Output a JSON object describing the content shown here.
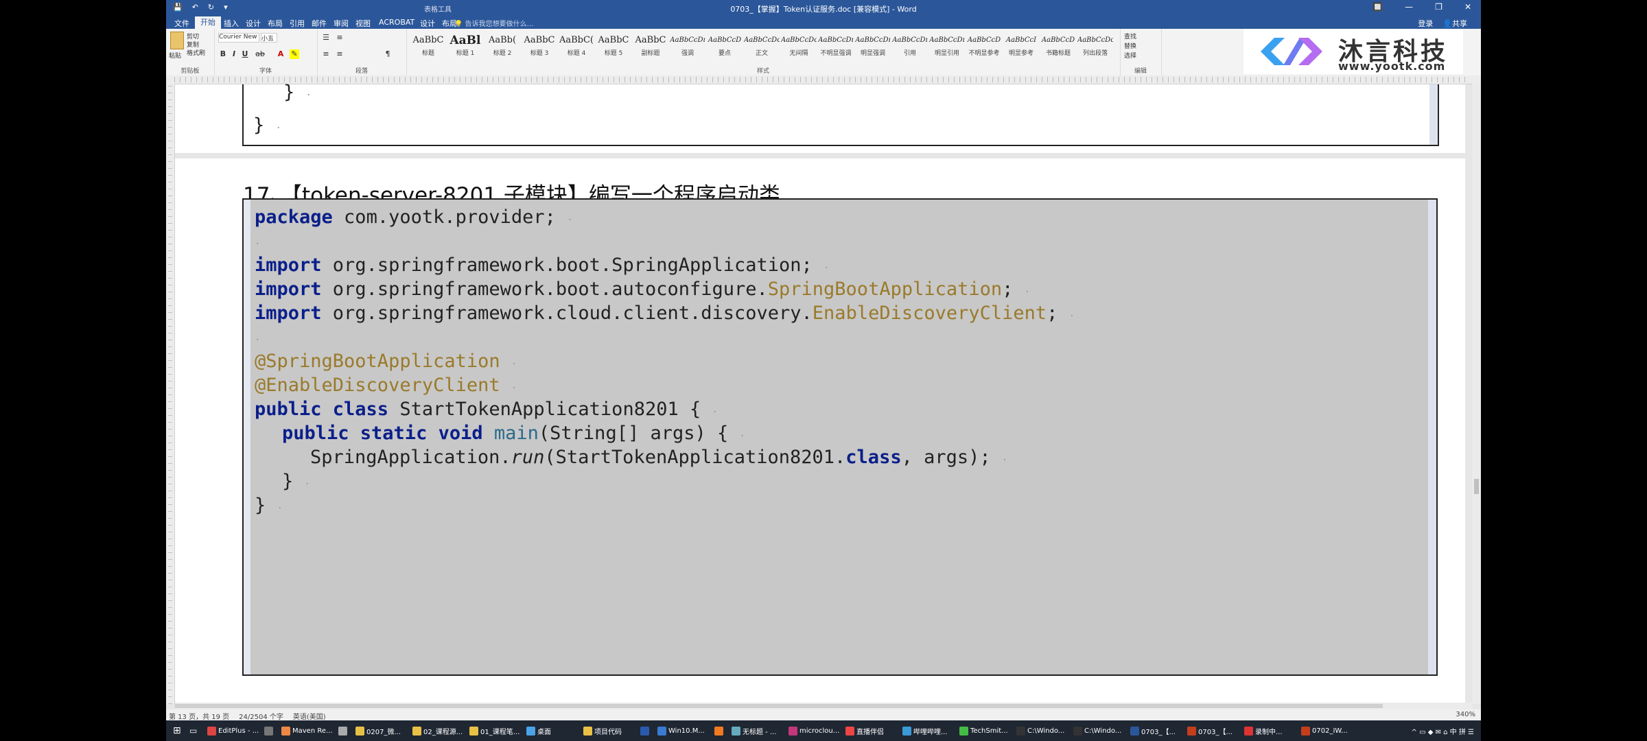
{
  "titlebar": {
    "title": "0703_【掌握】Token认证服务.doc [兼容模式] - Word",
    "context_tab": "表格工具",
    "qat": [
      "💾",
      "↶",
      "↻",
      "▾"
    ],
    "window_buttons": [
      "🔲",
      "—",
      "❐",
      "✕"
    ]
  },
  "tabs": {
    "items": [
      "文件",
      "开始",
      "插入",
      "设计",
      "布局",
      "引用",
      "邮件",
      "审阅",
      "视图",
      "ACROBAT",
      "设计",
      "布局"
    ],
    "search_placeholder": "告诉我您想要做什么...",
    "login": "登录",
    "share": "共享"
  },
  "ribbon": {
    "clipboard": {
      "paste": "粘贴",
      "cut": "剪切",
      "copy": "复制",
      "format_painter": "格式刷",
      "label": "剪贴板"
    },
    "font": {
      "font_name": "Courier New",
      "font_size": "小五",
      "label": "字体"
    },
    "paragraph": {
      "label": "段落"
    },
    "styles": {
      "label": "样式",
      "items": [
        {
          "preview": "AaBbC",
          "name": "标题"
        },
        {
          "preview": "AaBl",
          "name": "标题 1"
        },
        {
          "preview": "AaBb(",
          "name": "标题 2"
        },
        {
          "preview": "AaBbC",
          "name": "标题 3"
        },
        {
          "preview": "AaBbC(",
          "name": "标题 4"
        },
        {
          "preview": "AaBbC",
          "name": "标题 5"
        },
        {
          "preview": "AaBbC",
          "name": "副标题"
        },
        {
          "preview": "AaBbCcDı",
          "name": "强调"
        },
        {
          "preview": "AaBbCcD",
          "name": "要点"
        },
        {
          "preview": "AaBbCcDc",
          "name": "正文"
        },
        {
          "preview": "AaBbCcDc",
          "name": "无间隔"
        },
        {
          "preview": "AaBbCcDı",
          "name": "不明显强调"
        },
        {
          "preview": "AaBbCcDı",
          "name": "明显强调"
        },
        {
          "preview": "AaBbCcDı",
          "name": "引用"
        },
        {
          "preview": "AaBbCcDı",
          "name": "明显引用"
        },
        {
          "preview": "AaBbCcD",
          "name": "不明显参考"
        },
        {
          "preview": "AaBbCcI",
          "name": "明显参考"
        },
        {
          "preview": "AaBbCcD",
          "name": "书籍标题"
        },
        {
          "preview": "AaBbCcDc",
          "name": "列出段落"
        }
      ]
    },
    "editing": {
      "find": "查找",
      "replace": "替换",
      "select": "选择",
      "label": "编辑"
    }
  },
  "logo": {
    "cn": "沐言科技",
    "en": "www.yootk.com"
  },
  "document": {
    "prev_lines": [
      "}",
      "}"
    ],
    "heading": "17、【token-server-8201 子模块】编写一个程序启动类",
    "code": {
      "l1_kw": "package",
      "l1_rest": " com.yootk.provider;",
      "l3_kw": "import",
      "l3_rest": " org.springframework.boot.SpringApplication;",
      "l4_kw": "import",
      "l4_rest": " org.springframework.boot.autoconfigure.",
      "l4_ann": "SpringBootApplication",
      "l4_end": ";",
      "l5_kw": "import",
      "l5_rest": " org.springframework.cloud.client.discovery.",
      "l5_ann": "EnableDiscoveryClient",
      "l5_end": ";",
      "l7": "@SpringBootApplication",
      "l8": "@EnableDiscoveryClient",
      "l9_kw": "public class",
      "l9_rest": " StartTokenApplication8201 {",
      "l10_kw": "public static void",
      "l10_m": "main",
      "l10_rest": "(String[] args) {",
      "l11_a": "SpringApplication.",
      "l11_run": "run",
      "l11_b": "(StartTokenApplication8201.",
      "l11_kw": "class",
      "l11_c": ", args);",
      "l12": "}",
      "l13": "}"
    }
  },
  "status": {
    "page": "第 13 页，共 19 页",
    "words": "24/2504 个字",
    "lang": "英语(美国)",
    "zoom": "340%"
  },
  "taskbar": {
    "items": [
      {
        "label": "EditPlus - ...",
        "color": "#d44"
      },
      {
        "label": "",
        "color": "#777"
      },
      {
        "label": "Maven Re...",
        "color": "#e84"
      },
      {
        "label": "",
        "color": "#aaa"
      },
      {
        "label": "0207_微...",
        "color": "#e8c046"
      },
      {
        "label": "02_课程源...",
        "color": "#e8c046"
      },
      {
        "label": "01_课程笔...",
        "color": "#e8c046"
      },
      {
        "label": "桌面",
        "color": "#4aa3e8"
      },
      {
        "label": "项目代码",
        "color": "#e8c046"
      },
      {
        "label": "",
        "color": "#2a5ab0"
      },
      {
        "label": "Win10.M...",
        "color": "#3a7ad0"
      },
      {
        "label": "",
        "color": "#f07a20"
      },
      {
        "label": "无标题 - ...",
        "color": "#6ab"
      },
      {
        "label": "microclou...",
        "color": "#c3367a"
      },
      {
        "label": "直播伴侣",
        "color": "#e44"
      },
      {
        "label": "哔哩哔哩...",
        "color": "#3a9ad8"
      },
      {
        "label": "TechSmit...",
        "color": "#4b4"
      },
      {
        "label": "C:\\Windo...",
        "color": "#333"
      },
      {
        "label": "C:\\Windo...",
        "color": "#333"
      },
      {
        "label": "0703_【...",
        "color": "#2b579a"
      },
      {
        "label": "0703_【...",
        "color": "#c43e1c"
      },
      {
        "label": "录制中...",
        "color": "#d33"
      },
      {
        "label": "0702_IW...",
        "color": "#c43e1c"
      }
    ],
    "tray": "^ ▭ ◆ ✉ ⌂ 中 拼 ☰"
  }
}
